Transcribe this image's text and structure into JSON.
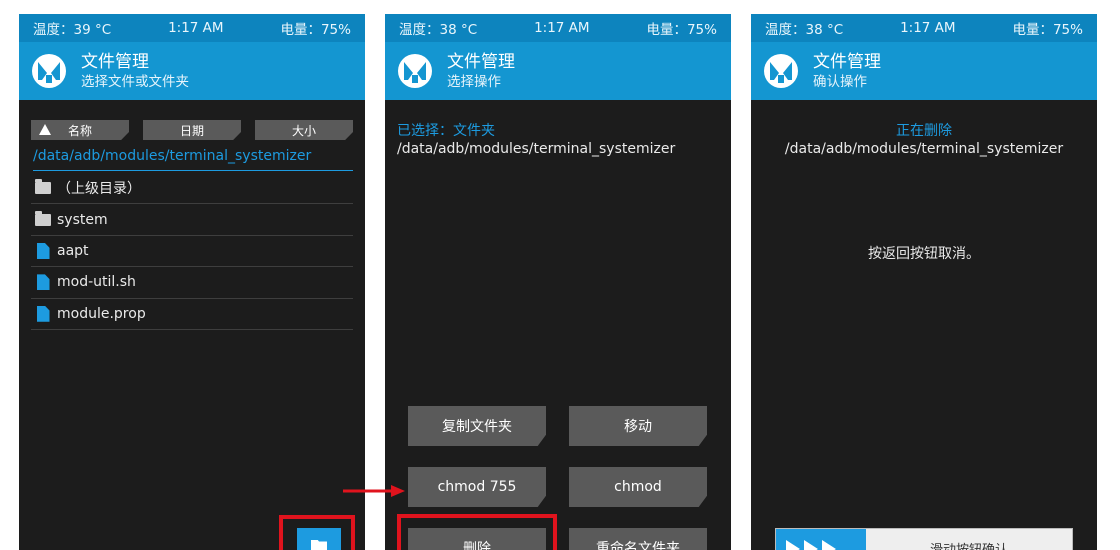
{
  "status": {
    "p1": {
      "temp": "温度：39 °C",
      "time": "1:17 AM",
      "battery": "电量：75%"
    },
    "p2": {
      "temp": "温度：38 °C",
      "time": "1:17 AM",
      "battery": "电量：75%"
    },
    "p3": {
      "temp": "温度：38 °C",
      "time": "1:17 AM",
      "battery": "电量：75%"
    }
  },
  "panel1": {
    "title": "文件管理",
    "subtitle": "选择文件或文件夹",
    "sort": {
      "name": "名称",
      "date": "日期",
      "size": "大小"
    },
    "path": "/data/adb/modules/terminal_systemizer",
    "files": [
      {
        "label": "（上级目录）",
        "icon": "folder-icon"
      },
      {
        "label": "system",
        "icon": "folder-icon"
      },
      {
        "label": "aapt",
        "icon": "file-icon"
      },
      {
        "label": "mod-util.sh",
        "icon": "file-icon"
      },
      {
        "label": "module.prop",
        "icon": "file-icon"
      }
    ]
  },
  "panel2": {
    "title": "文件管理",
    "subtitle": "选择操作",
    "selected": "已选择：文件夹",
    "path": "/data/adb/modules/terminal_systemizer",
    "buttons": {
      "copy": "复制文件夹",
      "move": "移动",
      "chmod755": "chmod 755",
      "chmod": "chmod",
      "delete": "删除",
      "rename": "重命名文件夹"
    }
  },
  "panel3": {
    "title": "文件管理",
    "subtitle": "确认操作",
    "deleting": "正在删除",
    "path": "/data/adb/modules/terminal_systemizer",
    "cancel_hint": "按返回按钮取消。",
    "slider_text": "滑动按钮确认"
  },
  "colors": {
    "accent": "#1d9be0",
    "header": "#1496d1",
    "statusbar": "#0d84be",
    "background": "#1c1c1c",
    "button": "#5a5a5a",
    "highlight": "#e0131d"
  }
}
